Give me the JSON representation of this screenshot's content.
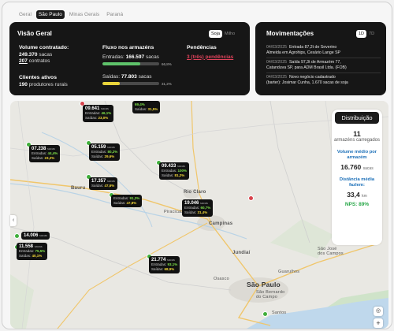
{
  "tabs": [
    "Geral",
    "São Paulo",
    "Minas Gerais",
    "Paraná"
  ],
  "overview": {
    "title": "Visão Geral",
    "toggle": [
      "Soja",
      "Milho"
    ],
    "volume_label": "Volume contratado:",
    "volume_value": "249.370",
    "volume_unit": "sacas",
    "contracts_value": "207",
    "contracts_unit": "contratos",
    "clients_label": "Clientes ativos",
    "clients_value": "190",
    "clients_unit": "produtores rurais",
    "flow_title": "Fluxo nos armazéns",
    "entries_label": "Entradas:",
    "entries_value": "166.597",
    "entries_unit": "sacas",
    "entries_pct": "66,8%",
    "exits_label": "Saídas:",
    "exits_value": "77.803",
    "exits_unit": "sacas",
    "exits_pct": "31,2%",
    "pending_title": "Pendências",
    "pending_text": "3 (três) pendências"
  },
  "movements": {
    "title": "Movimentações",
    "range": [
      "1D",
      "7D"
    ],
    "items": [
      {
        "date": "04/03/2025",
        "line1": "Entrada 87,2t de Severino",
        "line2": "Almeida em Agrohips, Cesário Lange SP"
      },
      {
        "date": "04/03/2025",
        "line1": "Saída 97,3t de Armazém 77,",
        "line2": "Catanduva SP, para ADM Brasil Ltda. (FOB)"
      },
      {
        "date": "04/03/2025",
        "line1": "Novo negócio cadastrado",
        "line2": "(barter): Josimar Cunha, 1.670 sacas de soja"
      }
    ]
  },
  "map": {
    "cities": {
      "bauru": "Bauru",
      "rio_claro": "Rio Claro",
      "campinas": "Campinas",
      "jundiai": "Jundiaí",
      "sao_paulo": "São Paulo",
      "sao_bernardo": "São Bernardo\ndo Campo",
      "guarulhos": "Guarulhos",
      "osasco": "Osasco",
      "santos": "Santos",
      "sao_jose": "São José\ndos Campos",
      "piracicaba": "Piracicaba"
    },
    "warehouses": [
      {
        "value": "09.641",
        "entries": "46,1%",
        "exits": "23,0%",
        "status": "red"
      },
      {
        "value": "",
        "entries": "",
        "exits": "31,5%",
        "top_pct": "69,4%",
        "status": "green"
      },
      {
        "value": "07.238",
        "entries": "44,4%",
        "exits": "23,2%",
        "status": "green"
      },
      {
        "value": "05.159",
        "entries": "80,2%",
        "exits": "29,6%",
        "status": "green"
      },
      {
        "value": "09.433",
        "entries": "100%",
        "exits": "81,2%",
        "status": "green"
      },
      {
        "value": "17.357",
        "entries": "47,6%",
        "exits": "",
        "status": "green"
      },
      {
        "value": "",
        "entries": "91,3%",
        "exits": "47,8%",
        "status": "green"
      },
      {
        "value": "19.046",
        "entries": "60,7%",
        "exits": "31,4%",
        "status": "red"
      },
      {
        "value": "14.006",
        "entries": "",
        "exits": "",
        "status": "green"
      },
      {
        "value": "11.558",
        "entries": "75,5%",
        "exits": "40,1%",
        "status": "green"
      },
      {
        "value": "21.774",
        "entries": "93,1%",
        "exits": "68,9%",
        "status": "green"
      }
    ],
    "entries_label": "Entradas:",
    "exits_label": "Saídas:",
    "unit": "sacas"
  },
  "distribution": {
    "title": "Distribuição",
    "count": "11",
    "count_label": "armazéns carregados",
    "avg_label": "Volume médio por armazém",
    "avg_value": "16.760",
    "avg_unit": "sacas",
    "dist_label": "Distância média fazlem:",
    "dist_value": "33,4",
    "dist_unit": "km",
    "nps": "NPS: 89%"
  },
  "zoom": {
    "in": "+",
    "out": "−"
  },
  "colors": {
    "green": "#3fae3a",
    "red": "#d9434c",
    "accent_green": "#7ee04a",
    "accent_yellow": "#f2d83a"
  }
}
